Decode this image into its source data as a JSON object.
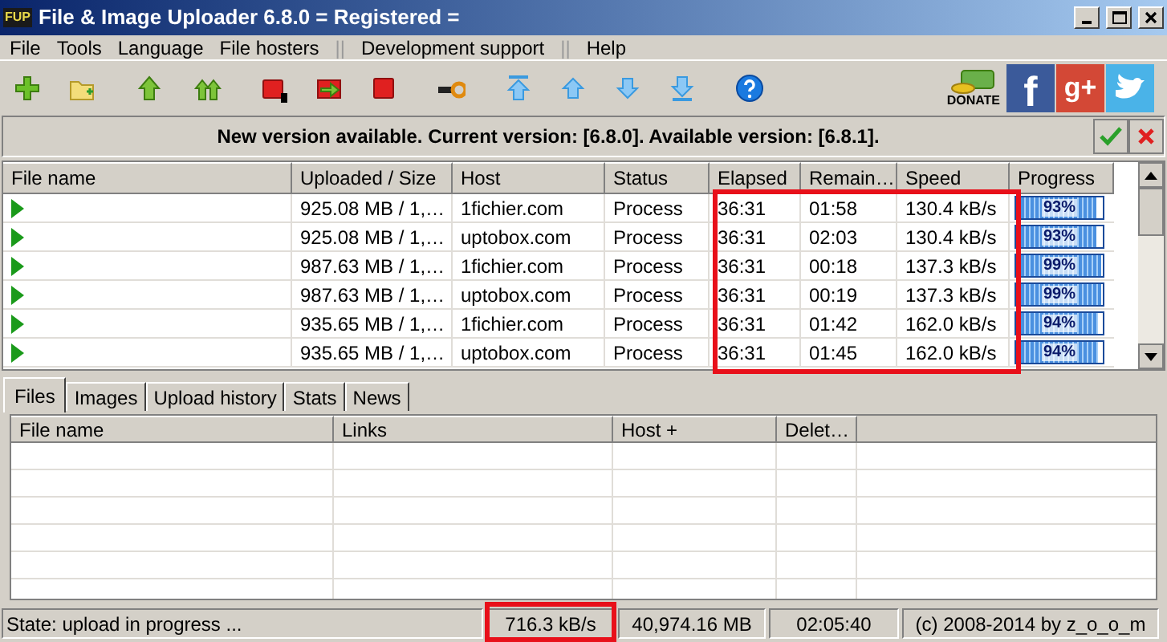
{
  "window": {
    "title": "File & Image Uploader 6.8.0  = Registered =",
    "app_badge": "FUP"
  },
  "menu": [
    {
      "label": "File",
      "kind": "item"
    },
    {
      "label": "Tools",
      "kind": "item"
    },
    {
      "label": "Language",
      "kind": "item"
    },
    {
      "label": "File hosters",
      "kind": "item"
    },
    {
      "label": "||",
      "kind": "sep"
    },
    {
      "label": "Development support",
      "kind": "item"
    },
    {
      "label": "||",
      "kind": "sep"
    },
    {
      "label": "Help",
      "kind": "item"
    }
  ],
  "toolbar": {
    "donate": "DONATE",
    "facebook": "f",
    "google_plus": "g+"
  },
  "update_bar": {
    "message": "New version available. Current version: [6.8.0]. Available version: [6.8.1]."
  },
  "uploads": {
    "columns": [
      "File name",
      "Uploaded / Size",
      "Host",
      "Status",
      "Elapsed",
      "Remain…",
      "Speed",
      "Progress"
    ],
    "rows": [
      {
        "uploaded": "925.08 MB / 1,…",
        "host": "1fichier.com",
        "status": "Process",
        "elapsed": "36:31",
        "remaining": "01:58",
        "speed": "130.4 kB/s",
        "level": 0.93,
        "progress": "93%"
      },
      {
        "uploaded": "925.08 MB / 1,…",
        "host": "uptobox.com",
        "status": "Process",
        "elapsed": "36:31",
        "remaining": "02:03",
        "speed": "130.4 kB/s",
        "level": 0.93,
        "progress": "93%"
      },
      {
        "uploaded": "987.63 MB / 1,…",
        "host": "1fichier.com",
        "status": "Process",
        "elapsed": "36:31",
        "remaining": "00:18",
        "speed": "137.3 kB/s",
        "level": 0.99,
        "progress": "99%"
      },
      {
        "uploaded": "987.63 MB / 1,…",
        "host": "uptobox.com",
        "status": "Process",
        "elapsed": "36:31",
        "remaining": "00:19",
        "speed": "137.3 kB/s",
        "level": 0.99,
        "progress": "99%"
      },
      {
        "uploaded": "935.65 MB / 1,…",
        "host": "1fichier.com",
        "status": "Process",
        "elapsed": "36:31",
        "remaining": "01:42",
        "speed": "162.0 kB/s",
        "level": 0.94,
        "progress": "94%"
      },
      {
        "uploaded": "935.65 MB / 1,…",
        "host": "uptobox.com",
        "status": "Process",
        "elapsed": "36:31",
        "remaining": "01:45",
        "speed": "162.0 kB/s",
        "level": 0.94,
        "progress": "94%"
      }
    ]
  },
  "tabs": [
    {
      "label": "Files",
      "selected": true
    },
    {
      "label": "Images",
      "selected": false
    },
    {
      "label": "Upload history",
      "selected": false
    },
    {
      "label": "Stats",
      "selected": false
    },
    {
      "label": "News",
      "selected": false
    }
  ],
  "files_table": {
    "columns": [
      "File name",
      "Links",
      "Host +",
      "Delet…"
    ]
  },
  "status_bar": {
    "state": "State: upload in progress ...",
    "speed": "716.3 kB/s",
    "total": "40,974.16 MB",
    "time": "02:05:40",
    "copyright": "(c) 2008-2014 by z_o_o_m"
  }
}
